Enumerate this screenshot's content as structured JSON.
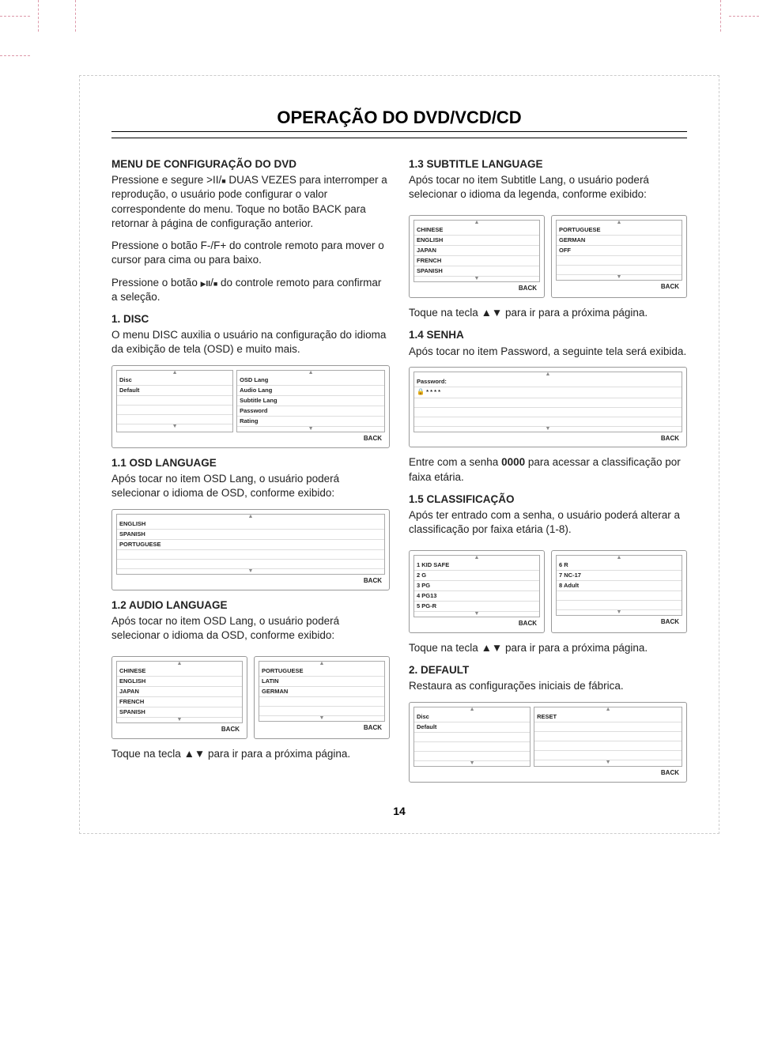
{
  "title": "OPERAÇÃO DO DVD/VCD/CD",
  "pageNumber": "14",
  "left": {
    "h1": "MENU DE CONFIGURAÇÃO DO DVD",
    "p1a": "Pressione e segure >II/",
    "p1b": " DUAS VEZES para interromper a reprodução, o usuário pode configurar o valor correspondente do menu. Toque no botão BACK para retornar à página de configuração anterior.",
    "p2": "Pressione o botão F-/F+ do controle remoto para mover o cursor para cima ou para baixo.",
    "p3a": "Pressione o botão ",
    "p3b": " do controle remoto para confirmar a seleção.",
    "h2": "1. DISC",
    "p4": "O menu DISC auxilia o usuário na configuração do idioma da exibição de tela (OSD) e muito mais.",
    "h3": "1.1 OSD LANGUAGE",
    "p5": "Após tocar no item OSD Lang, o usuário poderá selecionar o idioma de OSD, conforme exibido:",
    "h4": "1.2 AUDIO LANGUAGE",
    "p6": "Após tocar no item OSD Lang, o usuário poderá selecionar o idioma da OSD, conforme exibido:",
    "p7": "Toque na tecla ▲▼ para ir para a próxima página."
  },
  "right": {
    "h1": "1.3 SUBTITLE LANGUAGE",
    "p1": "Após tocar no item Subtitle Lang, o usuário poderá selecionar o idioma da legenda, conforme exibido:",
    "p2": "Toque na tecla ▲▼ para ir para a próxima página.",
    "h2": "1.4 SENHA",
    "p3": "Após tocar no item Password, a seguinte tela será exibida.",
    "p4a": "Entre com a senha ",
    "p4b": "0000",
    "p4c": " para acessar a classificação por faixa etária.",
    "h3": "1.5 CLASSIFICAÇÃO",
    "p5": "Após ter entrado com a senha, o usuário poderá alterar a classificação por faixa etária (1-8).",
    "p6": "Toque na tecla ▲▼ para ir para a próxima página.",
    "h4": "2. DEFAULT",
    "p7": "Restaura as configurações iniciais de fábrica."
  },
  "screens": {
    "disc": {
      "left": [
        "Disc",
        "Default"
      ],
      "right": [
        "OSD Lang",
        "Audio Lang",
        "Subtitle Lang",
        "Password",
        "Rating"
      ]
    },
    "osd": {
      "items": [
        "ENGLISH",
        "SPANISH",
        "PORTUGUESE"
      ]
    },
    "audioA": {
      "items": [
        "CHINESE",
        "ENGLISH",
        "JAPAN",
        "FRENCH",
        "SPANISH"
      ]
    },
    "audioB": {
      "items": [
        "PORTUGUESE",
        "LATIN",
        "GERMAN"
      ]
    },
    "subA": {
      "items": [
        "CHINESE",
        "ENGLISH",
        "JAPAN",
        "FRENCH",
        "SPANISH"
      ]
    },
    "subB": {
      "items": [
        "PORTUGUESE",
        "GERMAN",
        "OFF"
      ]
    },
    "pwd": {
      "label": "Password:",
      "value": "* * * *"
    },
    "ratingA": {
      "items": [
        "1 KID SAFE",
        "2 G",
        "3 PG",
        "4 PG13",
        "5 PG-R"
      ]
    },
    "ratingB": {
      "items": [
        "6 R",
        "7 NC-17",
        "8 Adult"
      ]
    },
    "default": {
      "left": [
        "Disc",
        "Default"
      ],
      "right": [
        "RESET"
      ]
    },
    "back": "BACK"
  }
}
